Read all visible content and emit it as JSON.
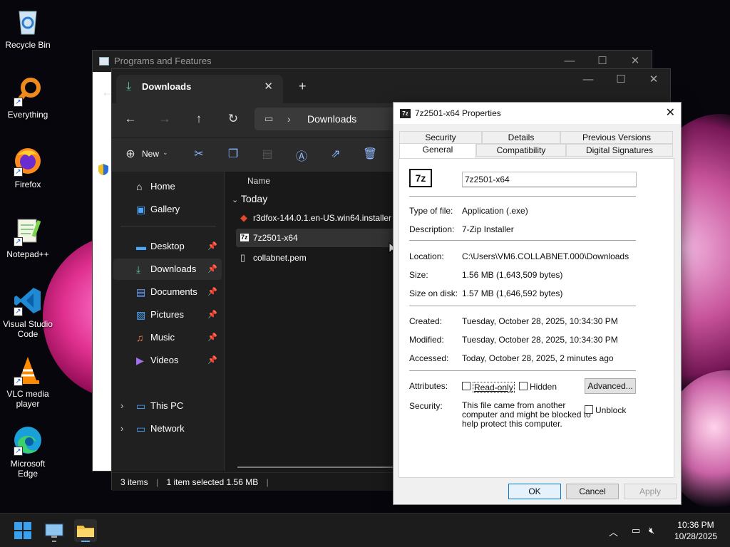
{
  "desktop": {
    "icons": [
      {
        "label": "Recycle Bin"
      },
      {
        "label": "Everything"
      },
      {
        "label": "Firefox"
      },
      {
        "label": "Notepad++"
      },
      {
        "label": "Visual Studio Code"
      },
      {
        "label": "VLC media player"
      },
      {
        "label": "Microsoft Edge"
      }
    ]
  },
  "bg_window": {
    "title": "Programs and Features"
  },
  "explorer": {
    "tab_title": "Downloads",
    "breadcrumb": "Downloads",
    "toolbar": {
      "new_label": "New"
    },
    "nav": [
      {
        "label": "Home"
      },
      {
        "label": "Gallery"
      },
      {
        "label": "Desktop"
      },
      {
        "label": "Downloads"
      },
      {
        "label": "Documents"
      },
      {
        "label": "Pictures"
      },
      {
        "label": "Music"
      },
      {
        "label": "Videos"
      },
      {
        "label": "This PC"
      },
      {
        "label": "Network"
      }
    ],
    "column_name": "Name",
    "group": "Today",
    "files": [
      {
        "name": "r3dfox-144.0.1.en-US.win64.installer"
      },
      {
        "name": "7z2501-x64"
      },
      {
        "name": "collabnet.pem"
      }
    ],
    "status": {
      "items": "3 items",
      "selected": "1 item selected  1.56 MB"
    }
  },
  "props": {
    "title": "7z2501-x64 Properties",
    "tabs_top": [
      "Security",
      "Details",
      "Previous Versions"
    ],
    "tabs_bottom": [
      "General",
      "Compatibility",
      "Digital Signatures"
    ],
    "icon_text": "7z",
    "name": "7z2501-x64",
    "fields": {
      "type_label": "Type of file:",
      "type_value": "Application (.exe)",
      "desc_label": "Description:",
      "desc_value": "7-Zip Installer",
      "loc_label": "Location:",
      "loc_value": "C:\\Users\\VM6.COLLABNET.000\\Downloads",
      "size_label": "Size:",
      "size_value": "1.56 MB (1,643,509 bytes)",
      "disk_label": "Size on disk:",
      "disk_value": "1.57 MB (1,646,592 bytes)",
      "created_label": "Created:",
      "created_value": "Tuesday, October 28, 2025, 10:34:30 PM",
      "modified_label": "Modified:",
      "modified_value": "Tuesday, October 28, 2025, 10:34:30 PM",
      "accessed_label": "Accessed:",
      "accessed_value": "Today, October 28, 2025, 2 minutes ago",
      "attr_label": "Attributes:",
      "readonly": "Read-only",
      "hidden": "Hidden",
      "advanced": "Advanced...",
      "sec_label": "Security:",
      "sec_text_1": "This file came from another",
      "sec_text_2": "computer and might be blocked to",
      "sec_text_3": "help protect this computer.",
      "unblock": "Unblock"
    },
    "buttons": {
      "ok": "OK",
      "cancel": "Cancel",
      "apply": "Apply"
    }
  },
  "taskbar": {
    "time": "10:36 PM",
    "date": "10/28/2025"
  }
}
